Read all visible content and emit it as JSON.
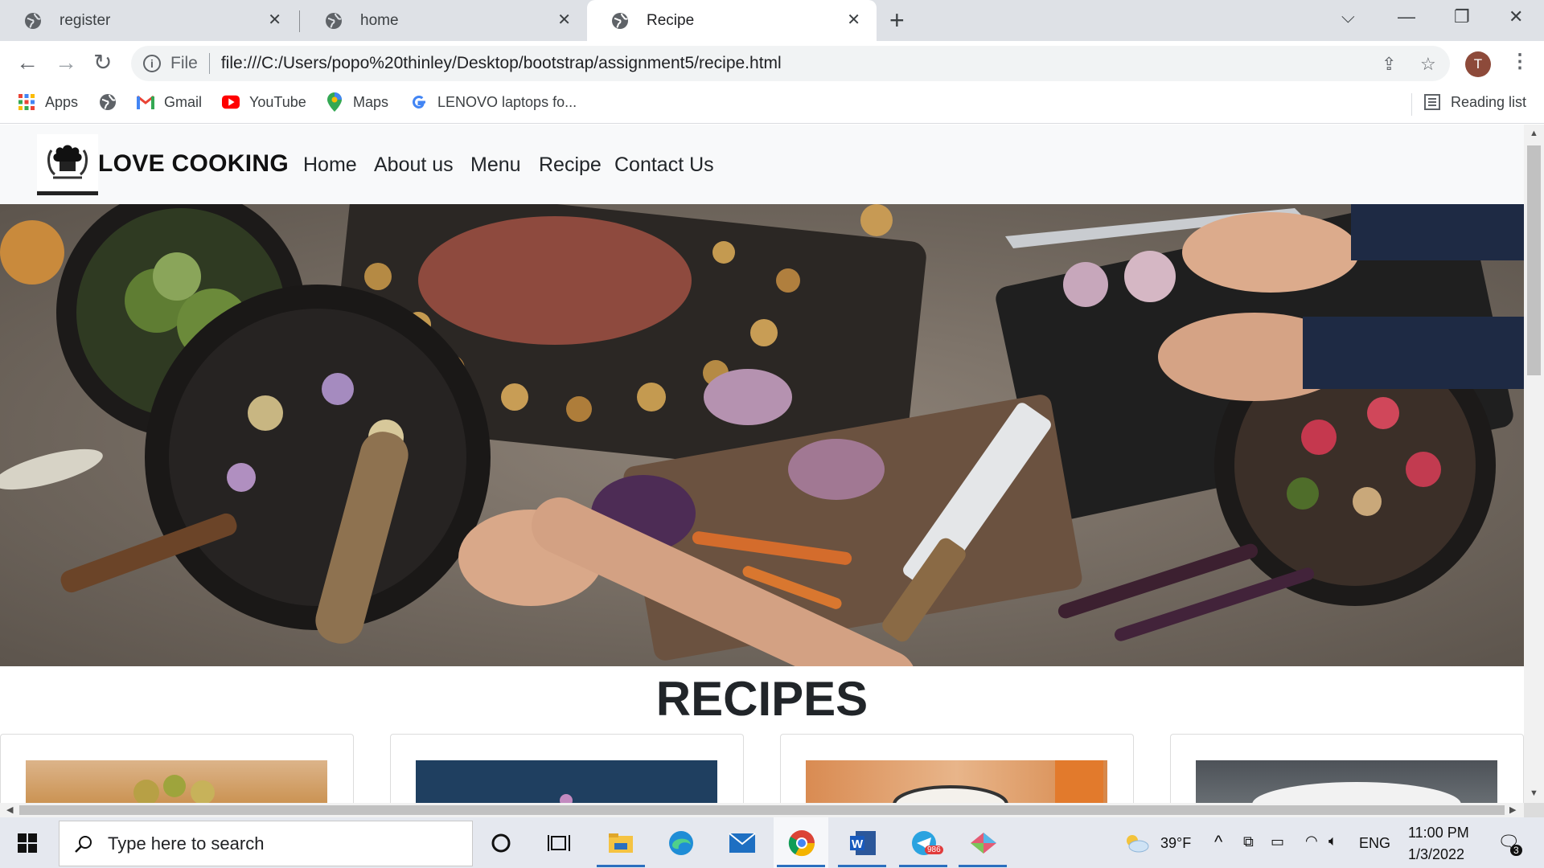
{
  "browser": {
    "tabs": [
      {
        "title": "register",
        "favicon": "globe-icon",
        "active": false
      },
      {
        "title": "home",
        "favicon": "globe-icon",
        "active": false
      },
      {
        "title": "Recipe",
        "favicon": "globe-icon",
        "active": true
      }
    ],
    "address": {
      "scheme_label": "File",
      "url": "file:///C:/Users/popo%20thinley/Desktop/bootstrap/assignment5/recipe.html"
    },
    "profile_initial": "T",
    "bookmarks": [
      {
        "label": "Apps",
        "icon": "apps-grid-icon"
      },
      {
        "label": "",
        "icon": "globe-icon"
      },
      {
        "label": "Gmail",
        "icon": "gmail-icon"
      },
      {
        "label": "YouTube",
        "icon": "youtube-icon"
      },
      {
        "label": "Maps",
        "icon": "maps-pin-icon"
      },
      {
        "label": "LENOVO laptops fo...",
        "icon": "google-g-icon"
      }
    ],
    "reading_list": "Reading list"
  },
  "site": {
    "brand": "LOVE COOKING",
    "nav": [
      "Home",
      "About us",
      "Menu",
      "Recipe",
      "Contact Us"
    ],
    "section_title": "RECIPES",
    "card_count": 4
  },
  "taskbar": {
    "search_placeholder": "Type here to search",
    "weather": "39°F",
    "language": "ENG",
    "time": "11:00 PM",
    "date": "1/3/2022",
    "telegram_badge": "986",
    "notification_count": "3"
  },
  "colors": {
    "tabstrip": "#dee1e6",
    "site_nav_bg": "#f8f9fa",
    "taskbar": "#e5e8ef",
    "taskbar_accent": "#2b6fbf"
  }
}
